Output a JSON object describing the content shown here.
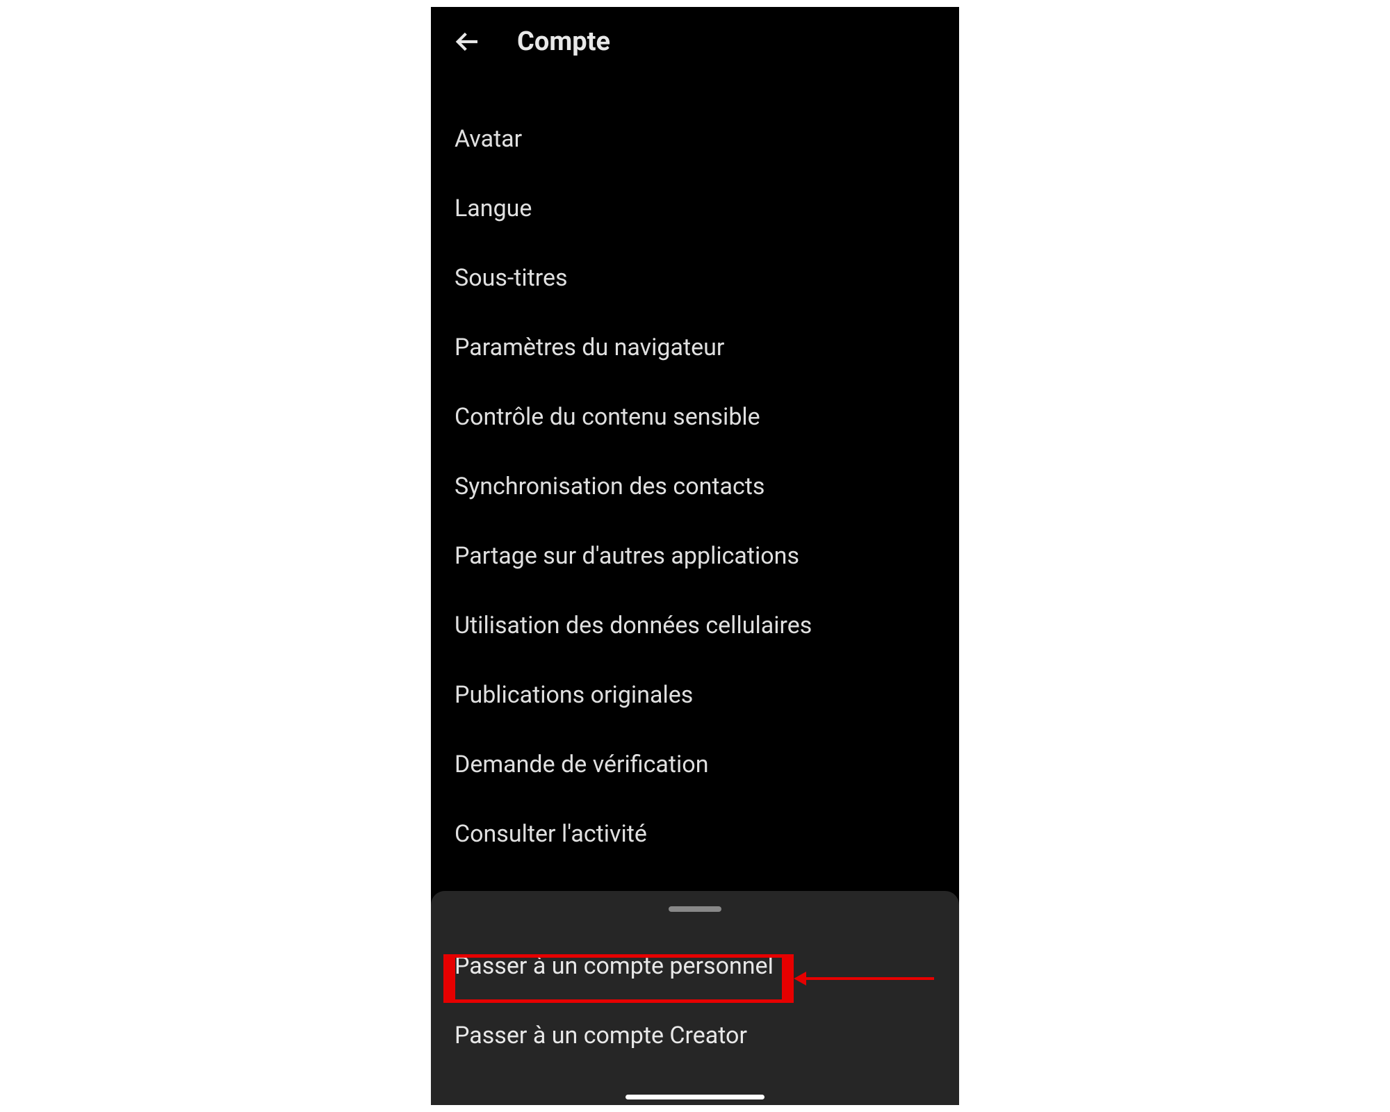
{
  "header": {
    "title": "Compte"
  },
  "menu": {
    "items": [
      {
        "label": "Avatar"
      },
      {
        "label": "Langue"
      },
      {
        "label": "Sous-titres"
      },
      {
        "label": "Paramètres du navigateur"
      },
      {
        "label": "Contrôle du contenu sensible"
      },
      {
        "label": "Synchronisation des contacts"
      },
      {
        "label": "Partage sur d'autres applications"
      },
      {
        "label": "Utilisation des données cellulaires"
      },
      {
        "label": "Publications originales"
      },
      {
        "label": "Demande de vérification"
      },
      {
        "label": "Consulter l'activité"
      }
    ]
  },
  "sheet": {
    "items": [
      {
        "label": "Passer à un compte personnel"
      },
      {
        "label": "Passer à un compte Creator"
      }
    ]
  },
  "annotation": {
    "highlight_color": "#e60000"
  }
}
